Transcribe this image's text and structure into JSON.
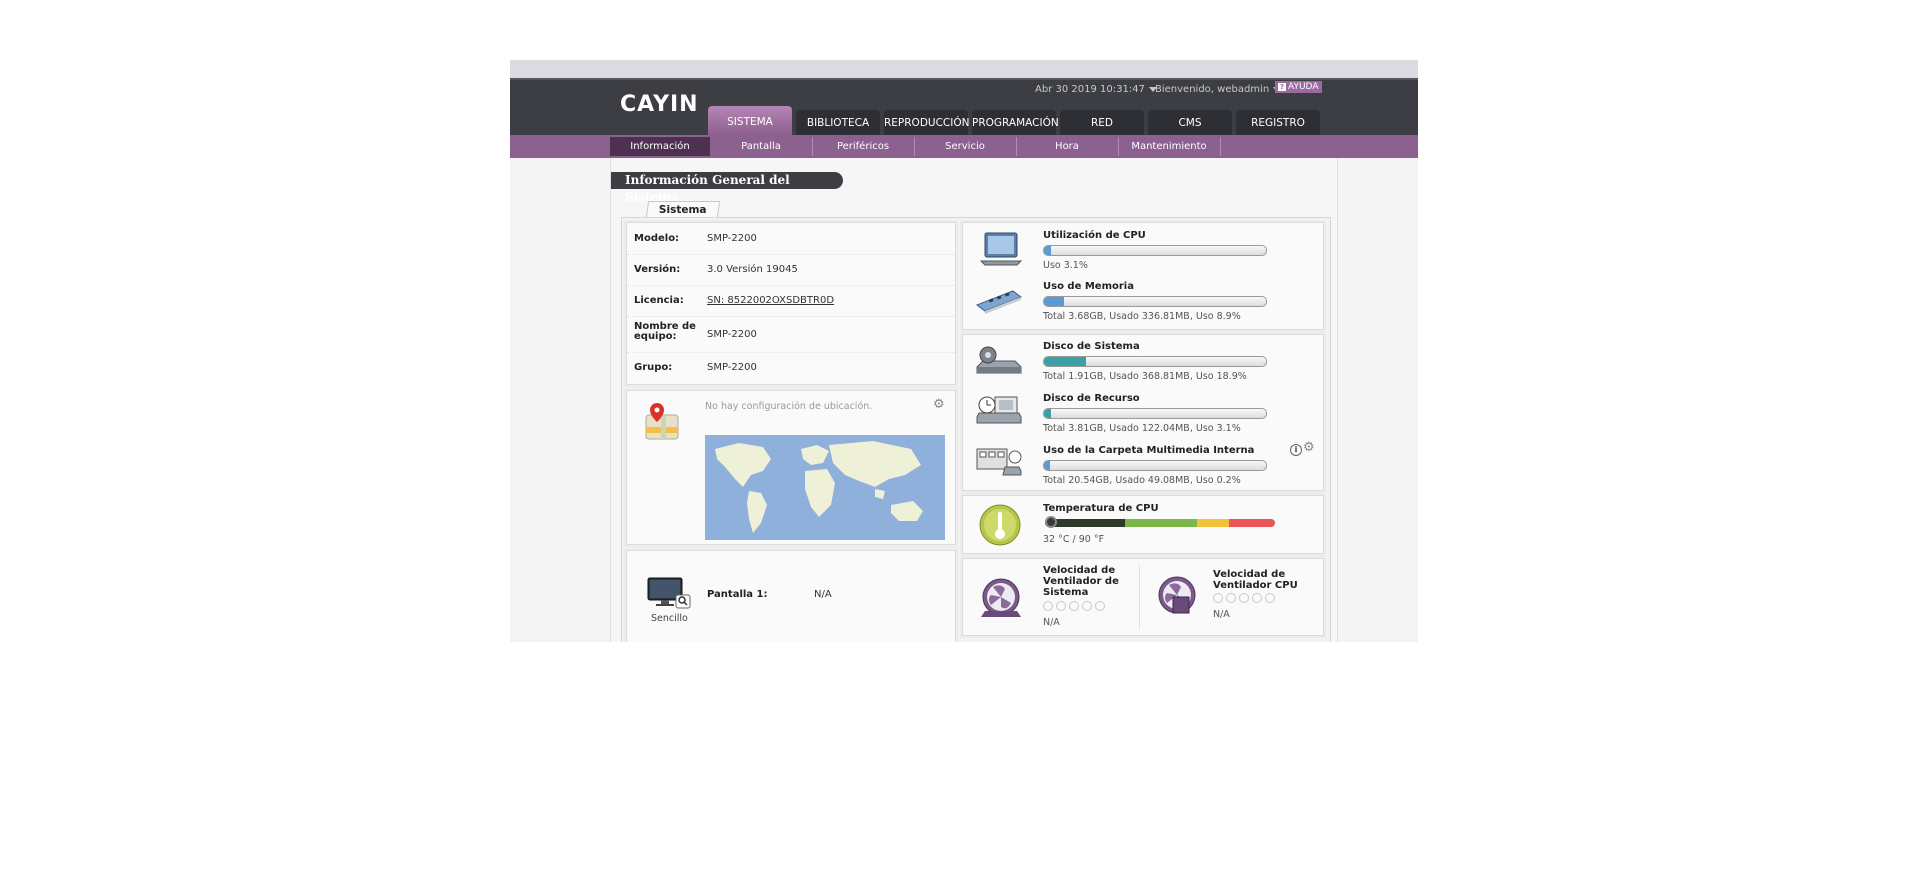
{
  "header": {
    "logo": "CAYIN",
    "datetime": "Abr 30 2019 10:31:47",
    "welcome": "Bienvenido, webadmin",
    "help": "AYUDA"
  },
  "tabs": [
    {
      "label": "SISTEMA",
      "active": true
    },
    {
      "label": "BIBLIOTECA"
    },
    {
      "label": "REPRODUCCIÓN"
    },
    {
      "label": "PROGRAMACIÓN"
    },
    {
      "label": "RED"
    },
    {
      "label": "CMS"
    },
    {
      "label": "REGISTRO"
    }
  ],
  "subnav": [
    {
      "label": "Información General",
      "active": true
    },
    {
      "label": "Pantalla"
    },
    {
      "label": "Periféricos"
    },
    {
      "label": "Servicio"
    },
    {
      "label": "Hora"
    },
    {
      "label": "Mantenimiento"
    }
  ],
  "page": {
    "title": "Información General del Sistema",
    "tab": "Sistema"
  },
  "info": {
    "rows": [
      {
        "label": "Modelo:",
        "value": "SMP-2200"
      },
      {
        "label": "Versión:",
        "value": "3.0 Versión 19045"
      },
      {
        "label": "Licencia:",
        "value": "SN: 8522002OXSDBTR0D"
      },
      {
        "label": "Nombre de equipo:",
        "value": "SMP-2200"
      },
      {
        "label": "Grupo:",
        "value": "SMP-2200"
      }
    ]
  },
  "location": {
    "message": "No hay configuración de ubicación."
  },
  "display": {
    "caption": "Sencillo",
    "label": "Pantalla 1:",
    "value": "N/A"
  },
  "metrics": {
    "cpu": {
      "title": "Utilización de CPU",
      "detail": "Uso 3.1%",
      "percent": 3.1
    },
    "memory": {
      "title": "Uso de Memoria",
      "detail": "Total 3.68GB, Usado 336.81MB, Uso 8.9%",
      "percent": 8.9
    },
    "system_disk": {
      "title": "Disco de Sistema",
      "detail": "Total 1.91GB, Usado 368.81MB, Uso 18.9%",
      "percent": 18.9
    },
    "resource_disk": {
      "title": "Disco de Recurso",
      "detail": "Total 3.81GB, Usado 122.04MB, Uso 3.1%",
      "percent": 3.1
    },
    "media_folder": {
      "title": "Uso de la Carpeta Multimedia Interna",
      "detail": "Total 20.54GB, Usado 49.08MB, Uso 0.2%",
      "percent": 0.2
    },
    "cpu_temp": {
      "title": "Temperatura de CPU",
      "detail": "32 °C / 90 °F"
    },
    "fan_system": {
      "title": "Velocidad de Ventilador de Sistema",
      "value": "N/A"
    },
    "fan_cpu": {
      "title": "Velocidad de Ventilador CPU",
      "value": "N/A"
    }
  },
  "colors": {
    "header_bg": "#3c3e44",
    "accent_purple": "#8c608f",
    "bar_blue": "#5b9bd5",
    "bar_teal": "#3aa0a6"
  }
}
